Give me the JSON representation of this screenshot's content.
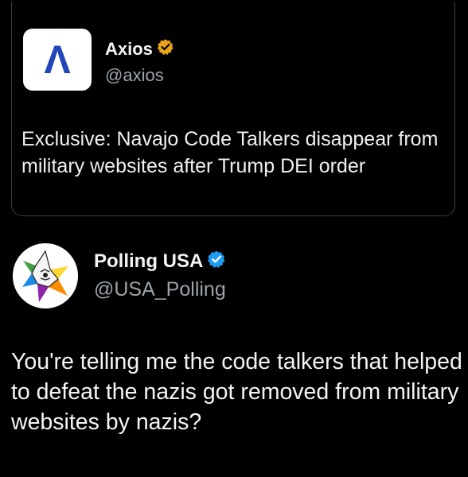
{
  "quoted_post": {
    "author_name": "Axios",
    "author_handle": "@axios",
    "text": "Exclusive: Navajo Code Talkers disappear from military websites after Trump DEI order",
    "logo_letter": "Λ",
    "verified": true,
    "badge_color": "#e8a317",
    "logo_letter_color": "#2346b8"
  },
  "main_post": {
    "author_name": "Polling USA",
    "author_handle": "@USA_Polling",
    "text": "You're telling me the code talkers that helped to defeat the nazis got removed from military websites by nazis?",
    "verified": true,
    "badge_color": "#1d9bf0"
  },
  "icons": {
    "quoted_verified": "gold-verified-badge-icon",
    "main_verified": "blue-verified-badge-icon",
    "axios_logo": "axios-logo",
    "polling_logo": "polling-usa-star-logo"
  }
}
